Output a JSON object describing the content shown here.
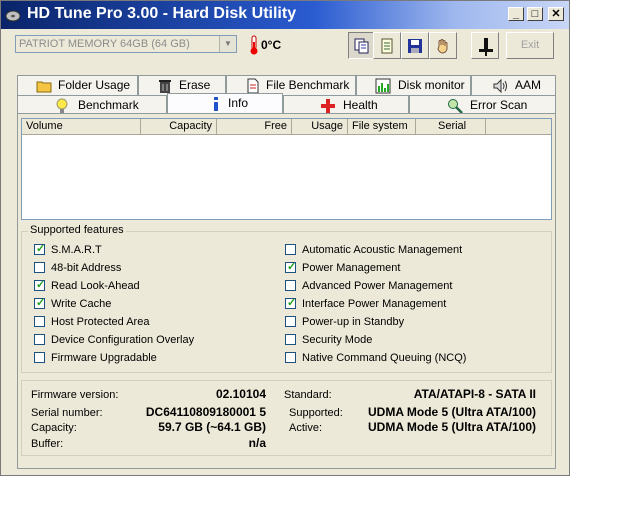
{
  "window": {
    "title": "HD Tune Pro 3.00 - Hard Disk Utility",
    "controls": {
      "minimize": "_",
      "maximize": "□",
      "close": "✕"
    }
  },
  "toolbar": {
    "drive_selected": "PATRIOT MEMORY 64GB (64 GB)",
    "temperature": "0°C",
    "exit_label": "Exit",
    "icons": [
      "copy-info-icon",
      "copy-text-icon",
      "save-icon",
      "options-hand-icon",
      "usb-plug-icon"
    ]
  },
  "tabs": {
    "top_row": [
      {
        "label": "Folder Usage",
        "icon": "folder-icon"
      },
      {
        "label": "Erase",
        "icon": "trash-icon"
      },
      {
        "label": "File Benchmark",
        "icon": "file-icon"
      },
      {
        "label": "Disk monitor",
        "icon": "monitor-icon"
      },
      {
        "label": "AAM",
        "icon": "speaker-icon"
      }
    ],
    "bottom_row": [
      {
        "label": "Benchmark",
        "icon": "bulb-icon"
      },
      {
        "label": "Info",
        "icon": "info-icon"
      },
      {
        "label": "Health",
        "icon": "health-cross-icon"
      },
      {
        "label": "Error Scan",
        "icon": "magnifier-icon"
      }
    ],
    "active": "Info"
  },
  "volume_list": {
    "columns": [
      "Volume",
      "Capacity",
      "Free",
      "Usage",
      "File system",
      "Serial"
    ]
  },
  "features": {
    "legend": "Supported features",
    "left": [
      {
        "label": "S.M.A.R.T",
        "checked": true
      },
      {
        "label": "48-bit Address",
        "checked": false
      },
      {
        "label": "Read Look-Ahead",
        "checked": true
      },
      {
        "label": "Write Cache",
        "checked": true
      },
      {
        "label": "Host Protected Area",
        "checked": false
      },
      {
        "label": "Device Configuration Overlay",
        "checked": false
      },
      {
        "label": "Firmware Upgradable",
        "checked": false
      }
    ],
    "right": [
      {
        "label": "Automatic Acoustic Management",
        "checked": false
      },
      {
        "label": "Power Management",
        "checked": true
      },
      {
        "label": "Advanced Power Management",
        "checked": false
      },
      {
        "label": "Interface Power Management",
        "checked": true
      },
      {
        "label": "Power-up in Standby",
        "checked": false
      },
      {
        "label": "Security Mode",
        "checked": false
      },
      {
        "label": "Native Command Queuing (NCQ)",
        "checked": false
      }
    ]
  },
  "details": {
    "firmware_label": "Firmware version:",
    "firmware_value": "02.10104",
    "serial_label": "Serial number:",
    "serial_value": "DC64110809180001 5",
    "capacity_label": "Capacity:",
    "capacity_value": "59.7 GB (~64.1 GB)",
    "buffer_label": "Buffer:",
    "buffer_value": "n/a",
    "standard_label": "Standard:",
    "standard_value": "ATA/ATAPI-8 - SATA II",
    "supported_label": "Supported:",
    "supported_value": "UDMA Mode 5 (Ultra ATA/100)",
    "active_label": "Active:",
    "active_value": "UDMA Mode 5 (Ultra ATA/100)"
  }
}
